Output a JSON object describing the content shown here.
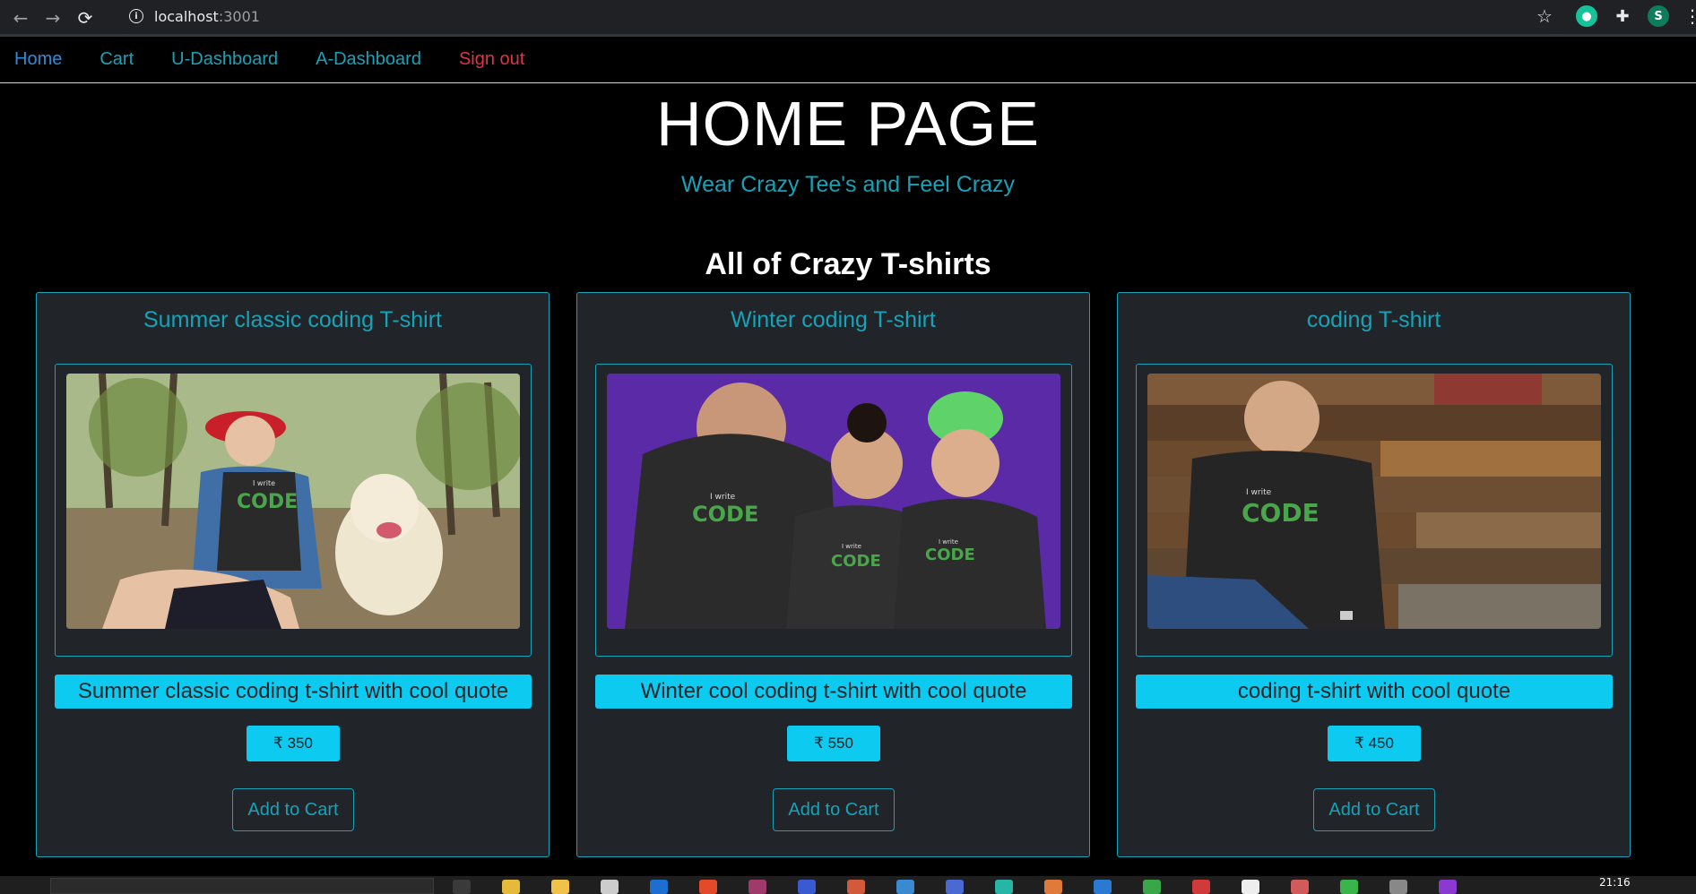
{
  "browser": {
    "url_host": "localhost",
    "url_port": ":3001",
    "extension_s": "S"
  },
  "nav": {
    "home": "Home",
    "cart": "Cart",
    "udash": "U-Dashboard",
    "adash": "A-Dashboard",
    "signout": "Sign out"
  },
  "hero": {
    "title": "HOME PAGE",
    "subtitle": "Wear Crazy Tee's and Feel Crazy"
  },
  "section_title": "All of Crazy T-shirts",
  "products": [
    {
      "title": "Summer classic coding T-shirt",
      "description": "Summer classic coding t-shirt with cool quote",
      "price": "₹ 350",
      "cta": "Add to Cart"
    },
    {
      "title": "Winter coding T-shirt",
      "description": "Winter cool coding t-shirt with cool quote",
      "price": "₹ 550",
      "cta": "Add to Cart"
    },
    {
      "title": "coding T-shirt",
      "description": "coding t-shirt with cool quote",
      "price": "₹ 450",
      "cta": "Add to Cart"
    }
  ],
  "photo_text": {
    "small": "I write",
    "big": "CODE"
  },
  "taskbar": {
    "clock": "21:16"
  },
  "colors": {
    "accent": "#17a2b8",
    "info_fill": "#0dcaf0",
    "danger": "#dc3545",
    "card_bg": "#212529"
  }
}
